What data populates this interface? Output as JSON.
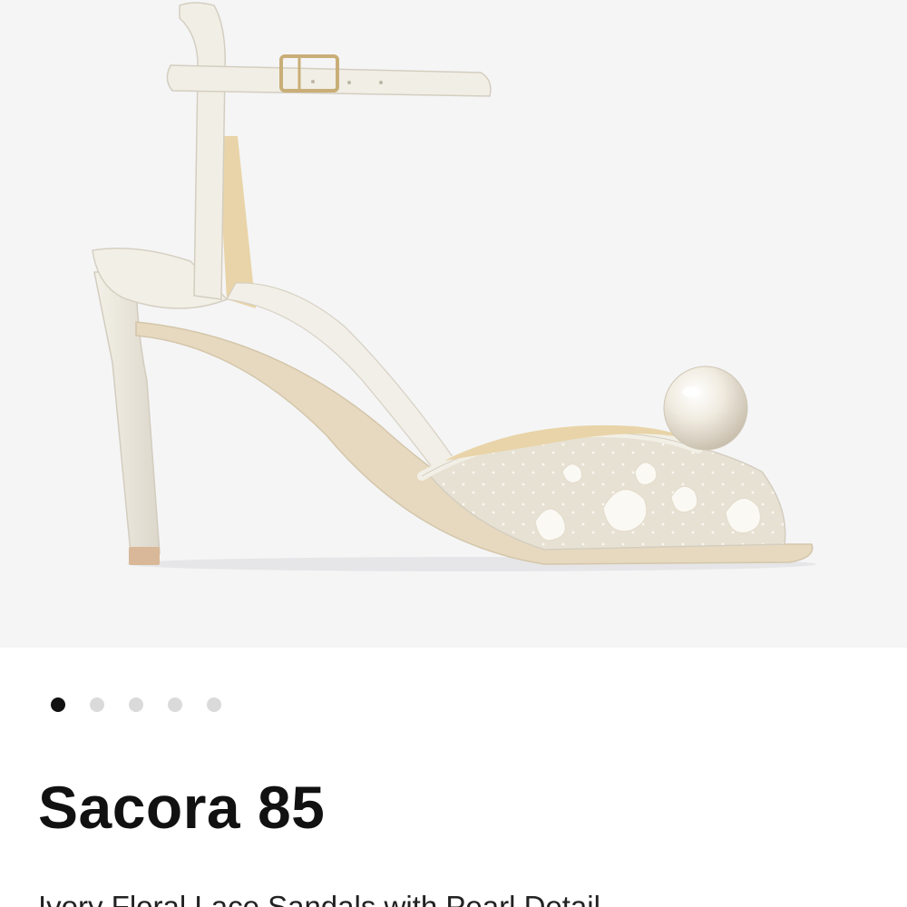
{
  "product": {
    "name": "Sacora 85",
    "description": "Ivory Floral Lace Sandals with Pearl Detail",
    "image": {
      "alt": "Ivory lace sandal with pearl detail, side view",
      "background_color": "#f5f5f6"
    }
  },
  "carousel": {
    "total": 5,
    "active_index": 0,
    "dots": [
      {
        "label": "Image 1",
        "active": true
      },
      {
        "label": "Image 2",
        "active": false
      },
      {
        "label": "Image 3",
        "active": false
      },
      {
        "label": "Image 4",
        "active": false
      },
      {
        "label": "Image 5",
        "active": false
      }
    ]
  },
  "colors": {
    "ivory": "#efeadf",
    "lining": "#e8d4a8",
    "pearl": "#e9e2d2",
    "hardware": "#c9ae78",
    "dot_active": "#111111",
    "dot_inactive": "#dadada"
  }
}
